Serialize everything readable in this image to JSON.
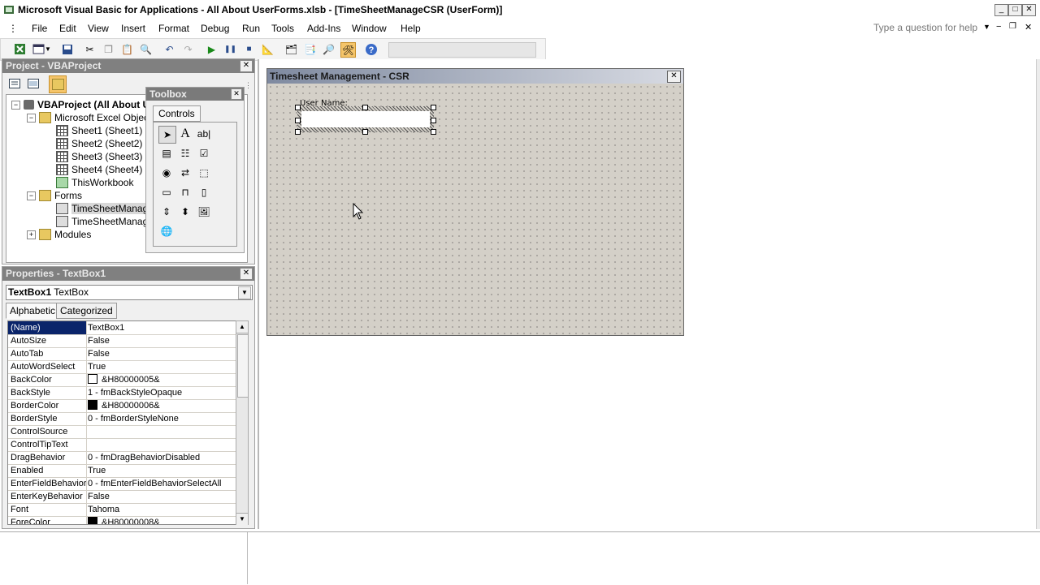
{
  "window": {
    "title": "Microsoft Visual Basic for Applications - All About UserForms.xlsb - [TimeSheetManageCSR (UserForm)]",
    "buttons": [
      "_",
      "□",
      "✕"
    ]
  },
  "menubar": {
    "items": [
      {
        "label": "File"
      },
      {
        "label": "Edit"
      },
      {
        "label": "View"
      },
      {
        "label": "Insert"
      },
      {
        "label": "Format"
      },
      {
        "label": "Debug"
      },
      {
        "label": "Run"
      },
      {
        "label": "Tools"
      },
      {
        "label": "Add-Ins"
      },
      {
        "label": "Window"
      },
      {
        "label": "Help"
      }
    ],
    "help_placeholder": "Type a question for help"
  },
  "project": {
    "title": "Project - VBAProject",
    "tree": [
      {
        "label": "VBAProject (All About U"
      },
      {
        "label": "Microsoft Excel Objects"
      },
      {
        "label": "Sheet1 (Sheet1)"
      },
      {
        "label": "Sheet2 (Sheet2)"
      },
      {
        "label": "Sheet3 (Sheet3)"
      },
      {
        "label": "Sheet4 (Sheet4)"
      },
      {
        "label": "ThisWorkbook"
      },
      {
        "label": "Forms"
      },
      {
        "label": "TimeSheetManageC"
      },
      {
        "label": "TimeSheetManageM"
      },
      {
        "label": "Modules"
      }
    ]
  },
  "toolbox": {
    "title": "Toolbox",
    "tab": "Controls"
  },
  "properties": {
    "title": "Properties - TextBox1",
    "object_name": "TextBox1",
    "object_type": "TextBox",
    "tabs": [
      "Alphabetic",
      "Categorized"
    ],
    "rows": [
      {
        "name": "(Name)",
        "value": "TextBox1"
      },
      {
        "name": "AutoSize",
        "value": "False"
      },
      {
        "name": "AutoTab",
        "value": "False"
      },
      {
        "name": "AutoWordSelect",
        "value": "True"
      },
      {
        "name": "BackColor",
        "value": "&H80000005&",
        "swatch": "#ffffff"
      },
      {
        "name": "BackStyle",
        "value": "1 - fmBackStyleOpaque"
      },
      {
        "name": "BorderColor",
        "value": "&H80000006&",
        "swatch": "#000000"
      },
      {
        "name": "BorderStyle",
        "value": "0 - fmBorderStyleNone"
      },
      {
        "name": "ControlSource",
        "value": ""
      },
      {
        "name": "ControlTipText",
        "value": ""
      },
      {
        "name": "DragBehavior",
        "value": "0 - fmDragBehaviorDisabled"
      },
      {
        "name": "Enabled",
        "value": "True"
      },
      {
        "name": "EnterFieldBehavior",
        "value": "0 - fmEnterFieldBehaviorSelectAll"
      },
      {
        "name": "EnterKeyBehavior",
        "value": "False"
      },
      {
        "name": "Font",
        "value": "Tahoma"
      },
      {
        "name": "ForeColor",
        "value": "&H80000008&",
        "swatch": "#000000"
      }
    ]
  },
  "userform": {
    "title": "Timesheet Management - CSR",
    "label_text": "User Name:",
    "textbox_value": ""
  },
  "colors": {
    "selection": "#0a246a",
    "pane_title": "#808080"
  }
}
